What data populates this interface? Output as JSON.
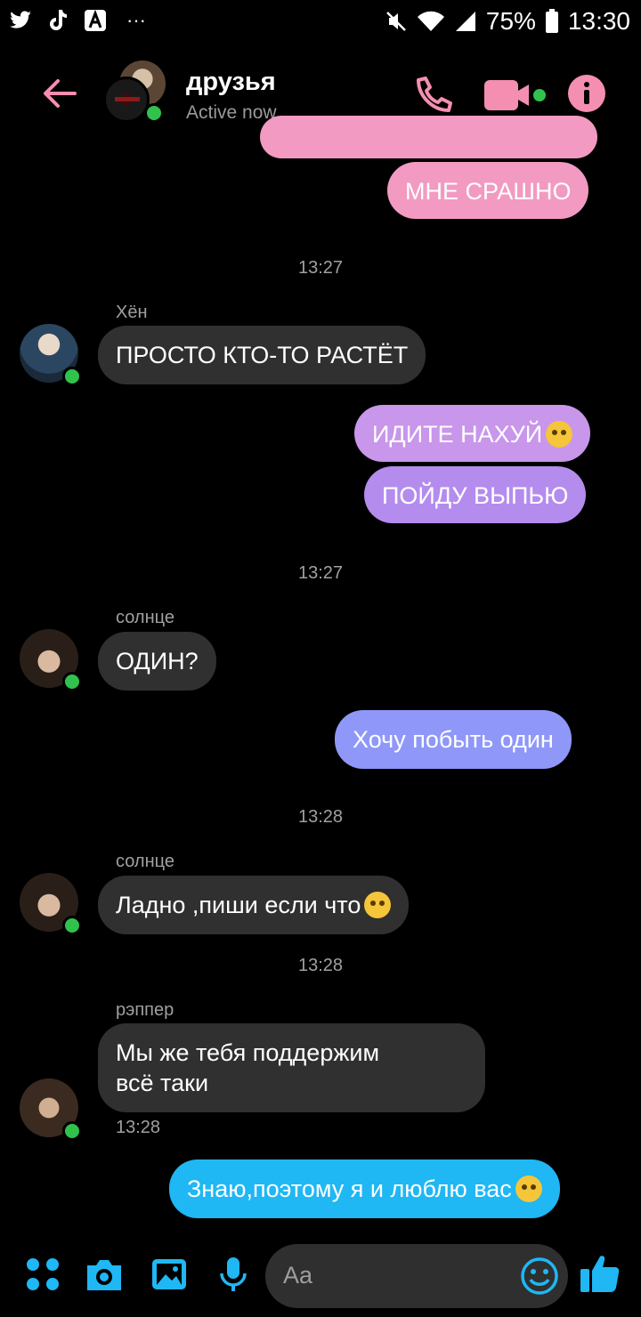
{
  "status_bar": {
    "left_icons": [
      "twitter-icon",
      "tiktok-icon",
      "app-a-icon",
      "more-dots-icon"
    ],
    "more": "···",
    "battery": "75%",
    "time": "13:30"
  },
  "header": {
    "title": "друзья",
    "subtitle": "Active now",
    "colors": {
      "accent": "#f48fb1"
    }
  },
  "messages": [
    {
      "type": "out",
      "text": "МНЕ СРАШНО",
      "color": "#f29ac2"
    },
    {
      "type": "timestamp",
      "text": "13:27"
    },
    {
      "type": "in",
      "sender": "Хён",
      "text": "ПРОСТО КТО-ТО РАСТЁТ"
    },
    {
      "type": "out",
      "text": "ИДИТЕ НАХУЙ",
      "emoji": "face-with-rolling-eyes-emoji",
      "color": "#c896ea"
    },
    {
      "type": "out",
      "text": "ПОЙДУ ВЫПЬЮ",
      "color": "#b48ced"
    },
    {
      "type": "timestamp",
      "text": "13:27"
    },
    {
      "type": "in",
      "sender": "солнце",
      "text": "ОДИН?"
    },
    {
      "type": "out",
      "text": "Хочу побыть один",
      "color": "#8f98f8"
    },
    {
      "type": "timestamp",
      "text": "13:28"
    },
    {
      "type": "in",
      "sender": "солнце",
      "text": "Ладно ,пиши если что",
      "emoji": "confounded-face-emoji"
    },
    {
      "type": "timestamp",
      "text": "13:28"
    },
    {
      "type": "in",
      "sender": "рэппер",
      "text_line1": "Мы же тебя поддержим",
      "text_line2": "всё таки",
      "time": "13:28"
    },
    {
      "type": "out",
      "text": "Знаю,поэтому я и люблю вас",
      "emoji": "pensive-face-emoji",
      "color": "#1fb7f4"
    }
  ],
  "composer": {
    "placeholder": "Aa",
    "icons": [
      "apps-grid-icon",
      "camera-icon",
      "gallery-icon",
      "microphone-icon",
      "emoji-icon",
      "thumbs-up-icon"
    ],
    "accent": "#1fb7f4"
  }
}
